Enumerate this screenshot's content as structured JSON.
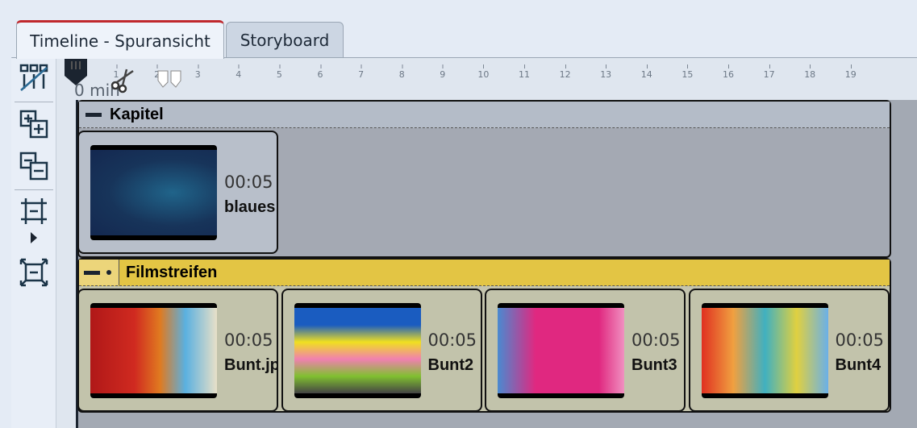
{
  "tabs": [
    {
      "label": "Timeline - Spuransicht",
      "active": true
    },
    {
      "label": "Storyboard",
      "active": false
    }
  ],
  "toolbar": {
    "icons": [
      "track-toggle-icon",
      "expand-all-icon",
      "collapse-all-icon",
      "fit-tracks-icon",
      "zoom-fit-icon"
    ]
  },
  "ruler": {
    "unit_label": "0 min",
    "ticks": [
      "1",
      "2",
      "3",
      "4",
      "5",
      "6",
      "7",
      "8",
      "9",
      "10",
      "11",
      "12",
      "13",
      "14",
      "15",
      "16",
      "17",
      "18",
      "19"
    ]
  },
  "groups": [
    {
      "title": "Kapitel",
      "color": "#b4bcc8",
      "clips": [
        {
          "duration": "00:05",
          "name": "blaues"
        }
      ]
    },
    {
      "title": "Filmstreifen",
      "color": "#e3c544",
      "clips": [
        {
          "duration": "00:05",
          "name": "Bunt.jpg"
        },
        {
          "duration": "00:05",
          "name": "Bunt2"
        },
        {
          "duration": "00:05",
          "name": "Bunt3"
        },
        {
          "duration": "00:05",
          "name": "Bunt4"
        }
      ]
    }
  ]
}
